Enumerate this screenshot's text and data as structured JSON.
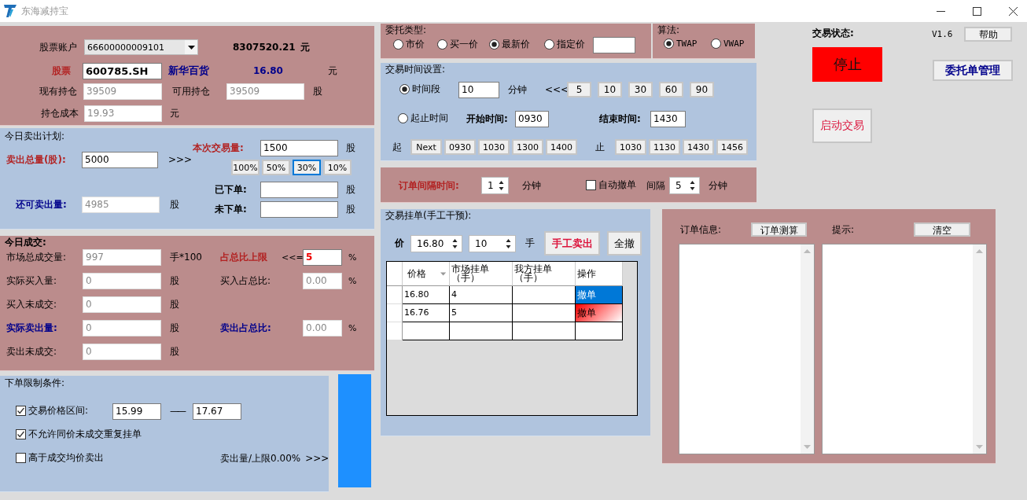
{
  "window": {
    "title": "东海减持宝"
  },
  "account": {
    "label": "股票账户",
    "value": "66600000009101",
    "balance": "8307520.21",
    "balance_unit": "元"
  },
  "stock": {
    "label": "股票",
    "code": "600785.SH",
    "name": "新华百货",
    "price": "16.80",
    "price_unit": "元"
  },
  "holding": {
    "label": "现有持仓",
    "value": "39509",
    "available_label": "可用持仓",
    "available": "39509",
    "unit": "股"
  },
  "cost": {
    "label": "持仓成本",
    "value": "19.93",
    "unit": "元"
  },
  "sell_plan": {
    "title": "今日卖出计划:",
    "total_label": "卖出总量(股):",
    "total": "5000",
    "arrows": ">>>",
    "trade_label": "本次交易量:",
    "trade": "1500",
    "trade_unit": "股",
    "ratios": [
      {
        "label": "100%",
        "selected": false
      },
      {
        "label": "50%",
        "selected": false
      },
      {
        "label": "30%",
        "selected": true
      },
      {
        "label": "10%",
        "selected": false
      }
    ],
    "remaining_label": "还可卖出量:",
    "remaining": "4985",
    "remaining_unit": "股",
    "placed_label": "已下单:",
    "placed_unit": "股",
    "unplaced_label": "未下单:",
    "unplaced_unit": "股"
  },
  "today": {
    "title": "今日成交:",
    "rows": [
      {
        "label": "市场总成交量:",
        "kind": "plain",
        "value": "997",
        "unit": "手*100",
        "right": {
          "label": "占总比上限",
          "kind": "alert",
          "prefix": "<<=",
          "value": "5",
          "editable": true,
          "unit": "%"
        }
      },
      {
        "label": "实际买入量:",
        "kind": "plain",
        "value": "0",
        "unit": "股",
        "right": {
          "label": "买入占总比:",
          "kind": "plain",
          "value": "0.00",
          "editable": false,
          "unit": "%"
        }
      },
      {
        "label": "买入未成交:",
        "kind": "plain",
        "value": "0",
        "unit": "股"
      },
      {
        "label": "实际卖出量:",
        "kind": "key",
        "value": "0",
        "unit": "股",
        "right": {
          "label": "卖出占总比:",
          "kind": "key",
          "value": "0.00",
          "editable": false,
          "unit": "%"
        }
      },
      {
        "label": "卖出未成交:",
        "kind": "plain",
        "value": "0",
        "unit": "股"
      }
    ]
  },
  "limits": {
    "title": "下单限制条件:",
    "price_range": {
      "label": "交易价格区间:",
      "checked": true,
      "low": "15.99",
      "separator": "——",
      "high": "17.67"
    },
    "options": [
      {
        "label": "不允许同价未成交重复挂单",
        "checked": true
      },
      {
        "label": "高于成交均价卖出",
        "checked": false
      }
    ],
    "progress_text": "卖出量/上限0.00%",
    "progress_arrows": ">>>"
  },
  "order_type": {
    "title": "委托类型:",
    "options": [
      {
        "label": "市价",
        "selected": false
      },
      {
        "label": "买一价",
        "selected": false
      },
      {
        "label": "最新价",
        "selected": true
      },
      {
        "label": "指定价",
        "selected": false
      }
    ]
  },
  "algorithm": {
    "title": "算法:",
    "options": [
      {
        "label": "TWAP",
        "selected": true
      },
      {
        "label": "VWAP",
        "selected": false
      }
    ]
  },
  "time_settings": {
    "title": "交易时间设置:",
    "period": {
      "label": "时间段",
      "selected": true,
      "value": "10",
      "unit": "分钟",
      "arrows": "<<<",
      "presets": [
        "5",
        "10",
        "30",
        "60",
        "90"
      ]
    },
    "range": {
      "label": "起止时间",
      "selected": false,
      "start_label": "开始时间:",
      "start": "0930",
      "end_label": "结束时间:",
      "end": "1430"
    },
    "start_label": "起",
    "start_presets": [
      "Next",
      "0930",
      "1030",
      "1300",
      "1400"
    ],
    "end_label": "止",
    "end_presets": [
      "1030",
      "1130",
      "1430",
      "1456"
    ]
  },
  "interval": {
    "label": "订单间隔时间:",
    "value": "1",
    "unit": "分钟",
    "auto_cancel": {
      "label": "自动撤单",
      "checked": false
    },
    "gap_label": "间隔",
    "gap": "5",
    "gap_unit": "分钟"
  },
  "manual": {
    "title": "交易挂单(手工干预):",
    "price_label": "价",
    "price": "16.80",
    "lots": "10",
    "lots_unit": "手",
    "sell_button": "手工卖出",
    "cancel_all_button": "全撤",
    "table": {
      "columns": [
        "价格",
        "市场挂单（手）",
        "我方挂单（手）",
        "操作"
      ],
      "rows": [
        {
          "price": "16.80",
          "market": "4",
          "action": "撤单",
          "kind": "primary"
        },
        {
          "price": "16.76",
          "market": "5",
          "action": "撤单",
          "kind": "danger"
        }
      ]
    }
  },
  "status": {
    "label": "交易状态:",
    "version": "V1.6",
    "help_button": "帮助",
    "state": "停止",
    "running": false,
    "manage_button": "委托单管理",
    "start_button": "启动交易"
  },
  "order_info": {
    "label": "订单信息:",
    "calc_button": "订单测算",
    "hint_label": "提示:",
    "clear_button": "清空"
  }
}
